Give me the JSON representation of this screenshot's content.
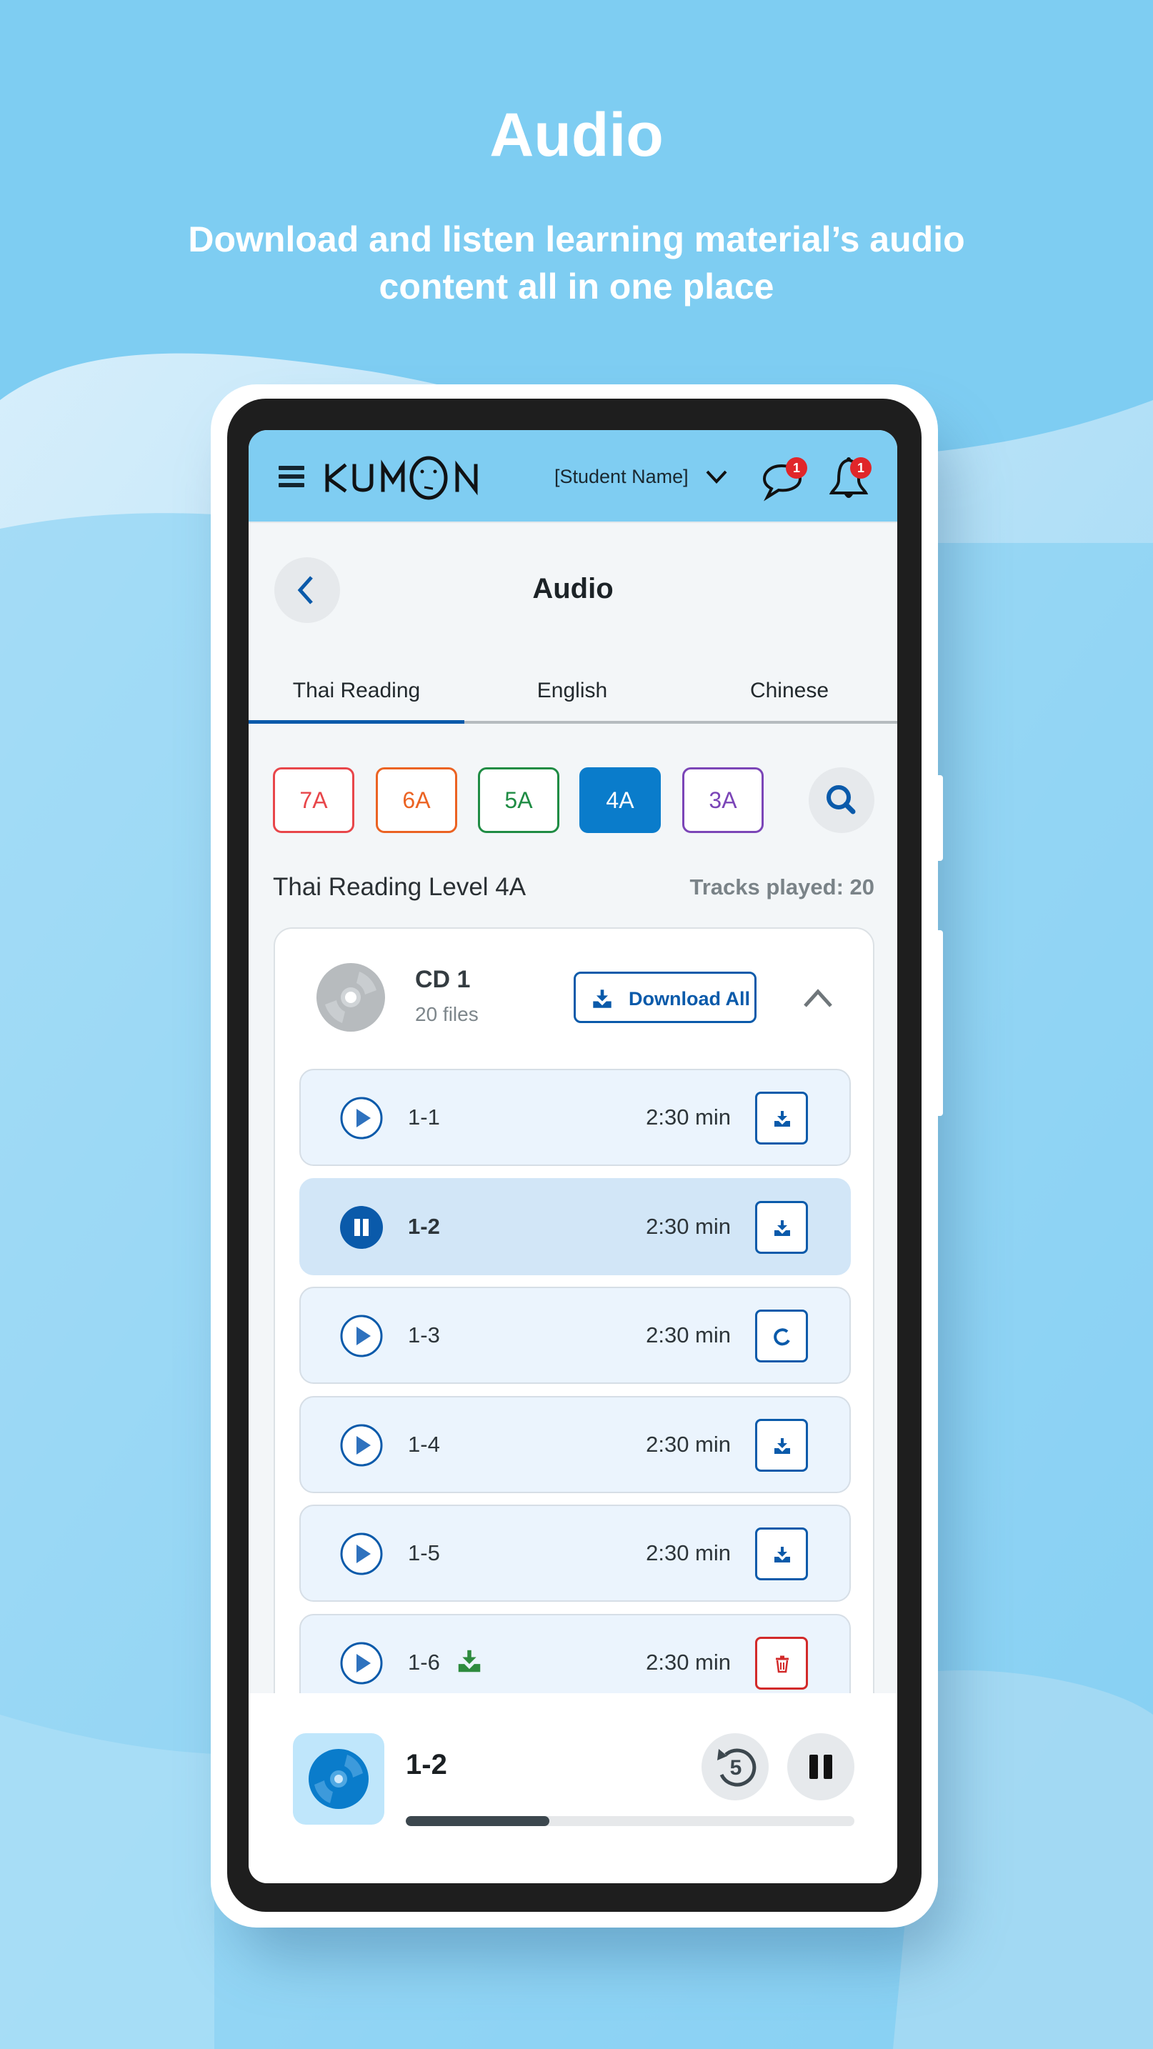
{
  "hero": {
    "title": "Audio",
    "subtitle": "Download and listen learning material’s audio content all in one place"
  },
  "app_header": {
    "logo": "KUMON",
    "menu_icon": "hamburger-menu-icon",
    "student_name": "[Student Name]",
    "messages_badge": "1",
    "notifications_badge": "1"
  },
  "page": {
    "title": "Audio",
    "back_icon": "chevron-left-icon"
  },
  "tabs": [
    {
      "label": "Thai Reading",
      "active": true
    },
    {
      "label": "English",
      "active": false
    },
    {
      "label": "Chinese",
      "active": false
    }
  ],
  "levels": [
    {
      "label": "7A",
      "color": "#E8464A",
      "selected": false
    },
    {
      "label": "6A",
      "color": "#EB6323",
      "selected": false
    },
    {
      "label": "5A",
      "color": "#1F8C44",
      "selected": false
    },
    {
      "label": "4A",
      "color": "#0A7CCB",
      "selected": true
    },
    {
      "label": "3A",
      "color": "#7B45B7",
      "selected": false
    }
  ],
  "level_info": {
    "title": "Thai Reading Level 4A",
    "tracks_played": "Tracks played: 20"
  },
  "cd": {
    "name": "CD 1",
    "files": "20 files",
    "download_all_label": "Download All",
    "expanded": true
  },
  "tracks": [
    {
      "name": "1-1",
      "duration": "2:30 min",
      "state": "idle",
      "action": "download"
    },
    {
      "name": "1-2",
      "duration": "2:30 min",
      "state": "playing",
      "action": "download"
    },
    {
      "name": "1-3",
      "duration": "2:30 min",
      "state": "idle",
      "action": "downloading"
    },
    {
      "name": "1-4",
      "duration": "2:30 min",
      "state": "idle",
      "action": "download"
    },
    {
      "name": "1-5",
      "duration": "2:30 min",
      "state": "idle",
      "action": "download"
    },
    {
      "name": "1-6",
      "duration": "2:30 min",
      "state": "idle",
      "action": "delete",
      "downloaded": true
    }
  ],
  "player": {
    "title": "1-2",
    "replay_seconds": "5",
    "progress": 0.32
  },
  "colors": {
    "background": "#7ECDF2",
    "header": "#7FCDF2",
    "primary": "#0A5AAA",
    "danger": "#D22A2A",
    "success": "#2E8B3E",
    "badge": "#E0262A"
  }
}
